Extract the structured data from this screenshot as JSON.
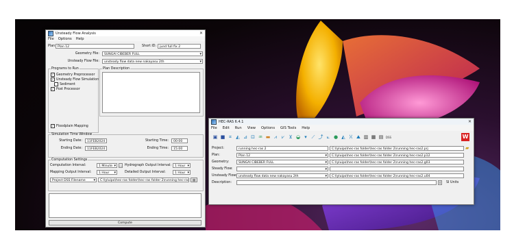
{
  "unsteady": {
    "title": "Unsteady Flow Analysis",
    "menu": [
      "File",
      "Options",
      "Help"
    ],
    "plan_label": "Plan:",
    "plan_value": "Plan 12",
    "short_id_label": "Short ID:",
    "short_id_value": "jund full fix 2",
    "geometry_label": "Geometry File:",
    "geometry_value": "SUNGAI CIBEBER FULL",
    "flow_label": "Unsteady Flow File:",
    "flow_value": "unsteady flow data new nakayasu 2th",
    "programs_title": "Programs to Run",
    "programs": [
      {
        "label": "Geometry Preprocessor",
        "checked": true
      },
      {
        "label": "Unsteady Flow Simulation",
        "checked": true
      },
      {
        "label": "Sediment",
        "checked": false
      },
      {
        "label": "Post Processor",
        "checked": true
      }
    ],
    "floodplain": {
      "label": "Floodplain Mapping",
      "checked": true
    },
    "plan_description_title": "Plan Description",
    "sim_window_title": "Simulation Time Window",
    "starting_date_label": "Starting Date:",
    "starting_date_value": "11FEB2024",
    "ending_date_label": "Ending Date:",
    "ending_date_value": "11FEB2024",
    "starting_time_label": "Starting Time:",
    "starting_time_value": "00:00",
    "ending_time_label": "Ending Time:",
    "ending_time_value": "15:00",
    "comp_title": "Computation Settings",
    "comp_interval_label": "Computation Interval:",
    "comp_interval_value": "1 Minute",
    "hydro_out_label": "Hydrograph Output Interval:",
    "hydro_out_value": "1 Hour",
    "map_out_label": "Mapping Output Interval:",
    "map_out_value": "1 Hour",
    "detailed_out_label": "Detailed Output Interval:",
    "detailed_out_value": "1 Hour",
    "dss_label": "Project DSS Filename",
    "dss_value": "C:\\lyluipo\\hec-ras folder\\hec-ras folder 2\\running hec-ras2.d",
    "compute_label": "Compute"
  },
  "hecras": {
    "title": "HEC-RAS 6.4.1",
    "menu": [
      "File",
      "Edit",
      "Run",
      "View",
      "Options",
      "GIS Tools",
      "Help"
    ],
    "toolbar_icons": [
      "save-icon",
      "open-icon",
      "geometry-icon",
      "steady-flow-icon",
      "unsteady-flow-icon",
      "quasi-flow-icon",
      "run-steady-icon",
      "run-unsteady-icon",
      "run-sediment-icon",
      "ras-mapper-icon",
      "cross-section-icon",
      "profile-icon",
      "rating-curve-icon",
      "xyz-icon",
      "stage-flow-icon",
      "general-profile-icon",
      "detailed-table-icon",
      "profile-table-icon",
      "summary-icon",
      "dss-icon"
    ],
    "rows": [
      {
        "label": "Project:",
        "value": "running hec-ras 2",
        "path": "C:\\lyluipo\\hec-ras folder\\hec-ras folder 2\\running hec-ras2.prj"
      },
      {
        "label": "Plan:",
        "value": "Plan 12",
        "path": "C:\\lyluipo\\hec-ras folder\\hec-ras folder 2\\running hec-ras2.p12"
      },
      {
        "label": "Geometry:",
        "value": "SUNGAI CIBEBER FULL",
        "path": "C:\\lyluipo\\hec-ras folder\\hec-ras folder 2\\running hec-ras2.g03"
      },
      {
        "label": "Steady Flow:",
        "value": "",
        "path": ""
      },
      {
        "label": "Unsteady Flow:",
        "value": "unsteady flow data new nakayasu 2th",
        "path": "C:\\lyluipo\\hec-ras folder\\hec-ras folder 2\\running hec-ras2.u04"
      },
      {
        "label": "Description:",
        "value": "",
        "path": ""
      }
    ],
    "units_label": "SI Units",
    "accent": "#d92323"
  }
}
